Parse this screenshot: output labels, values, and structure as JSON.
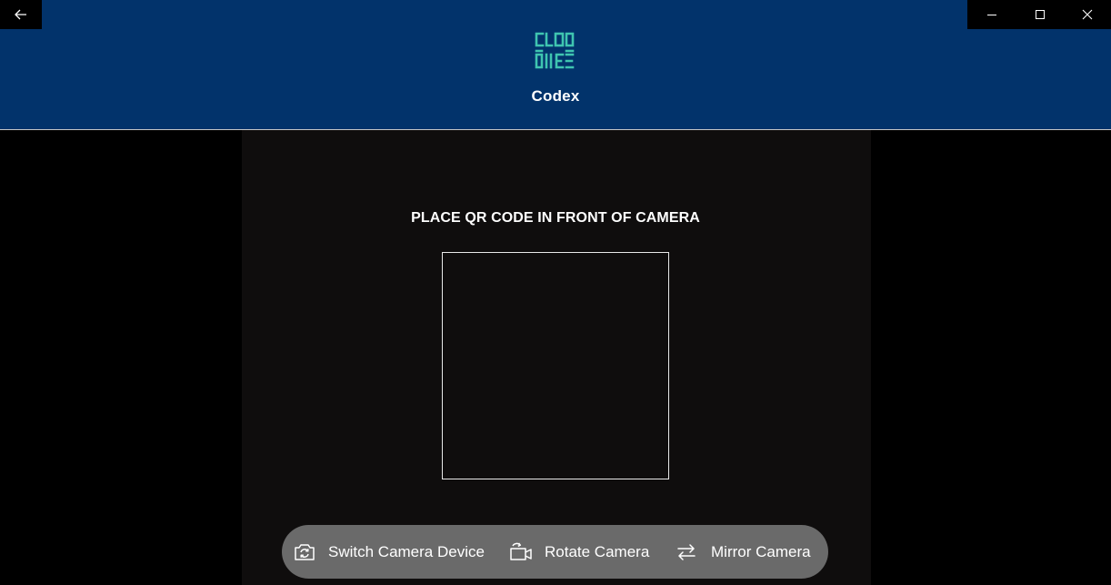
{
  "window": {
    "back_icon": "back-arrow-icon",
    "controls": [
      "minimize-icon",
      "maximize-icon",
      "close-icon"
    ]
  },
  "header": {
    "logo_icon": "codex-logo-icon",
    "title": "Codex",
    "background": "#02336b",
    "logo_color": "#3fc5b0"
  },
  "scanner": {
    "instruction": "PLACE QR CODE IN FRONT OF CAMERA"
  },
  "toolbar": {
    "switch_label": "Switch Camera Device",
    "switch_icon": "switch-camera-icon",
    "rotate_label": "Rotate Camera",
    "rotate_icon": "rotate-camera-icon",
    "mirror_label": "Mirror Camera",
    "mirror_icon": "mirror-arrows-icon"
  }
}
